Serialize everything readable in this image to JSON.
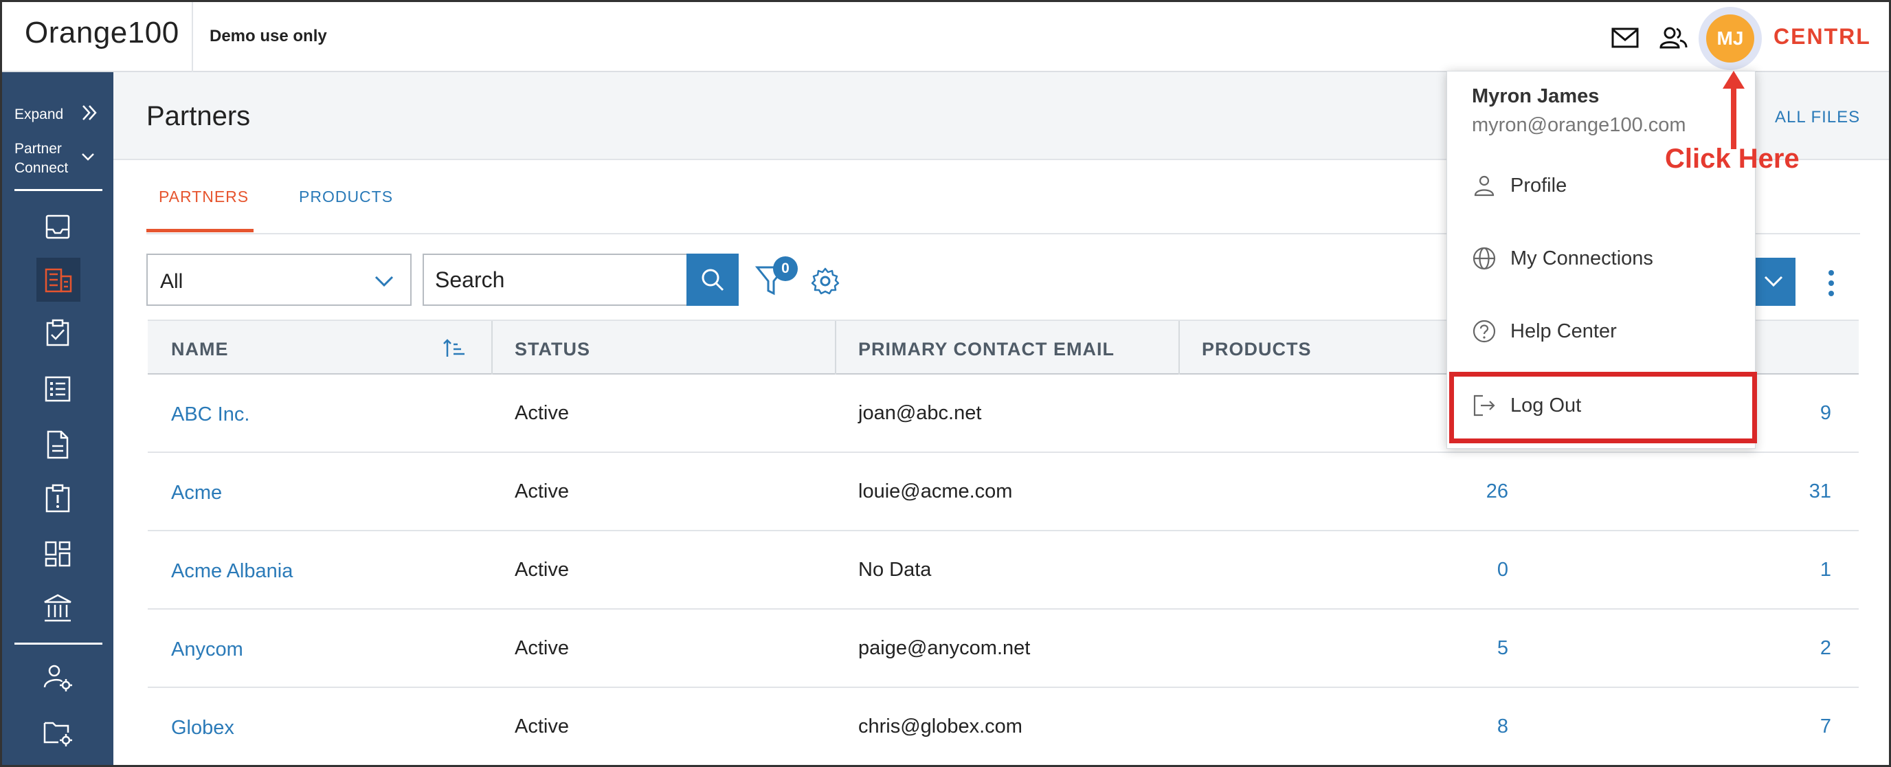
{
  "header": {
    "logo": "Orange100",
    "subtitle": "Demo use only",
    "avatar_initials": "MJ",
    "brand": "CENTRL",
    "icons": [
      "mail-icon",
      "users-icon"
    ]
  },
  "sidebar": {
    "expand_label": "Expand",
    "module_label": "Partner Connect",
    "items": [
      "inbox-icon",
      "building-icon",
      "clipboard-check-icon",
      "checklist-icon",
      "document-icon",
      "alert-clipboard-icon",
      "dashboard-icon",
      "institution-icon",
      "user-settings-icon",
      "folder-settings-icon"
    ]
  },
  "page": {
    "title": "Partners",
    "all_files": "ALL FILES"
  },
  "tabs": [
    {
      "label": "PARTNERS",
      "active": true
    },
    {
      "label": "PRODUCTS",
      "active": false
    }
  ],
  "toolbar": {
    "filter_select_value": "All",
    "search_placeholder": "Search",
    "filter_count": "0"
  },
  "table": {
    "columns": [
      "NAME",
      "STATUS",
      "PRIMARY CONTACT EMAIL",
      "PRODUCTS"
    ],
    "rows": [
      {
        "name": "ABC Inc.",
        "status": "Active",
        "email": "joan@abc.net",
        "products": "",
        "last": "9"
      },
      {
        "name": "Acme",
        "status": "Active",
        "email": "louie@acme.com",
        "products": "26",
        "last": "31"
      },
      {
        "name": "Acme Albania",
        "status": "Active",
        "email": "No Data",
        "products": "0",
        "last": "1"
      },
      {
        "name": "Anycom",
        "status": "Active",
        "email": "paige@anycom.net",
        "products": "5",
        "last": "2"
      },
      {
        "name": "Globex",
        "status": "Active",
        "email": "chris@globex.com",
        "products": "8",
        "last": "7"
      }
    ]
  },
  "user_menu": {
    "name": "Myron James",
    "email": "myron@orange100.com",
    "items": [
      {
        "label": "Profile",
        "icon": "person-icon"
      },
      {
        "label": "My Connections",
        "icon": "globe-icon"
      },
      {
        "label": "Help Center",
        "icon": "help-icon"
      },
      {
        "label": "Log Out",
        "icon": "logout-icon"
      }
    ]
  },
  "annotation": {
    "text": "Click Here",
    "color": "#e53a2f"
  },
  "colors": {
    "sidebar": "#2f4b6e",
    "accent": "#2a7ab8",
    "brand": "#e6442f",
    "avatar": "#f7a833",
    "highlight": "#d92727"
  }
}
